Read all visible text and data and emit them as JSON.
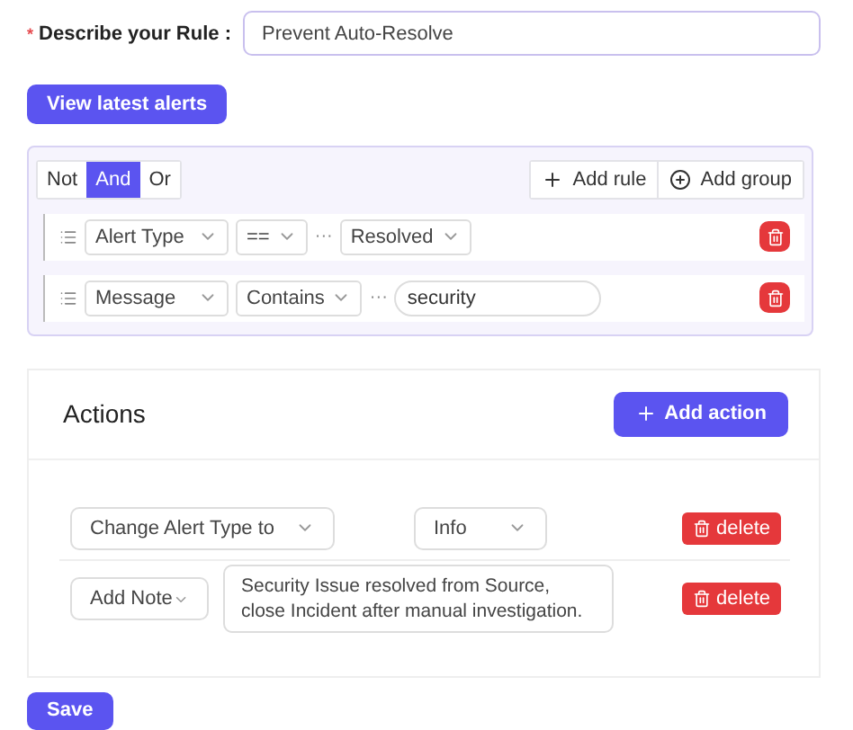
{
  "rule_name": {
    "required_mark": "*",
    "label": "Describe your Rule",
    "colon": ":",
    "value": "Prevent Auto-Resolve"
  },
  "view_alerts_button": "View latest alerts",
  "query_builder": {
    "combinators": [
      {
        "label": "Not",
        "selected": false
      },
      {
        "label": "And",
        "selected": true
      },
      {
        "label": "Or",
        "selected": false
      }
    ],
    "add_rule_button": "Add rule",
    "add_group_button": "Add group",
    "rules": [
      {
        "field": "Alert Type",
        "operator": "==",
        "separator": "···",
        "kind": "select",
        "value": "Resolved"
      },
      {
        "field": "Message",
        "operator": "Contains",
        "separator": "···",
        "kind": "input",
        "value": "security"
      }
    ]
  },
  "actions": {
    "title": "Actions",
    "add_button": "Add action",
    "items": [
      {
        "type": "Change Alert Type to",
        "kind": "select",
        "value": "Info",
        "delete_label": "delete"
      },
      {
        "type": "Add Note",
        "kind": "textarea",
        "value": "Security Issue resolved from Source, close Incident after manual investigation.",
        "delete_label": "delete"
      }
    ]
  },
  "save_button": "Save"
}
